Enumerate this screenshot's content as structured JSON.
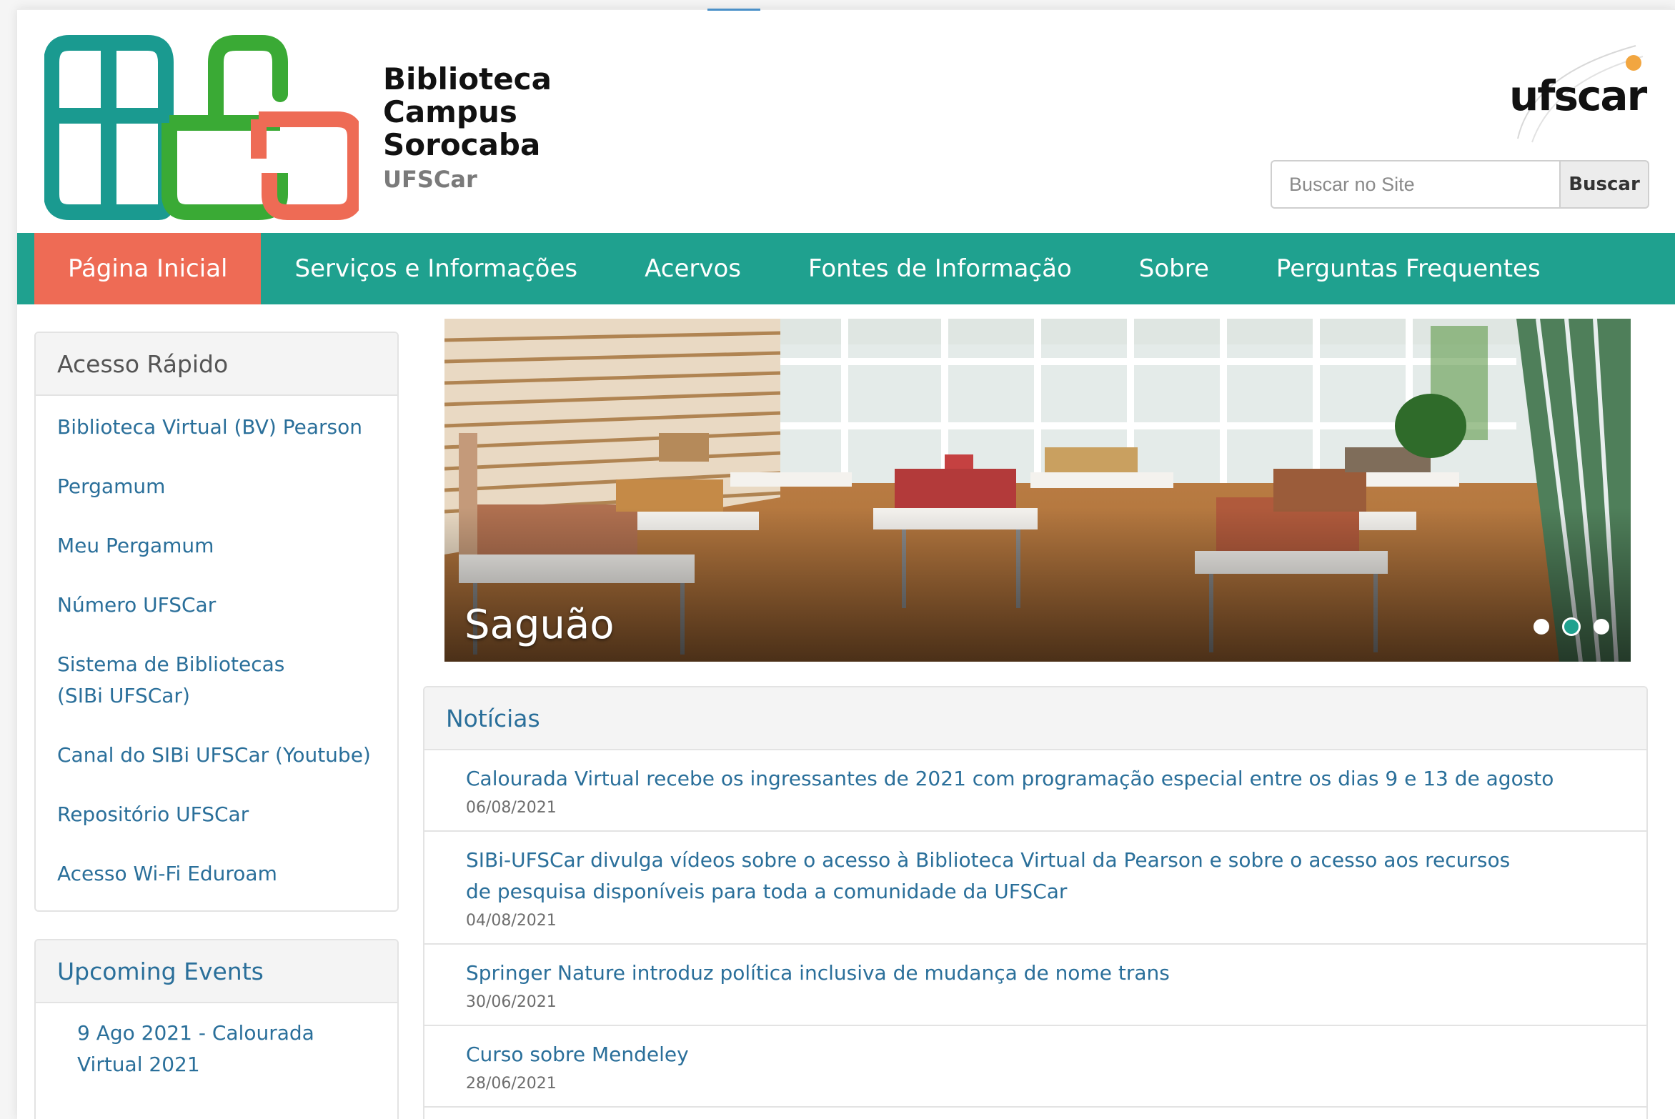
{
  "header": {
    "brand_lines": [
      "Biblioteca",
      "Campus",
      "Sorocaba"
    ],
    "brand_sub": "UFSCar",
    "partner_logo_text": "ufscar",
    "search": {
      "placeholder": "Buscar no Site",
      "button_label": "Buscar"
    }
  },
  "nav": {
    "items": [
      "Página Inicial",
      "Serviços e Informações",
      "Acervos",
      "Fontes de Informação",
      "Sobre",
      "Perguntas Frequentes"
    ],
    "active_index": 0
  },
  "sidebar": {
    "quick_access": {
      "title": "Acesso Rápido",
      "items": [
        "Biblioteca Virtual (BV) Pearson",
        "Pergamum",
        "Meu Pergamum",
        "Número UFSCar",
        "Sistema de Bibliotecas (SIBi UFSCar)",
        "Canal do SIBi UFSCar (Youtube)",
        "Repositório UFSCar",
        "Acesso Wi-Fi Eduroam"
      ]
    },
    "events": {
      "title": "Upcoming Events",
      "items": [
        "9 Ago 2021 - Calourada Virtual 2021"
      ]
    }
  },
  "slider": {
    "caption": "Saguão",
    "slide_count": 3,
    "active_slide": 1
  },
  "news": {
    "title": "Notícias",
    "items": [
      {
        "title": "Calourada Virtual recebe os ingressantes de 2021 com programação especial entre os dias 9 e 13 de agosto",
        "date": "06/08/2021"
      },
      {
        "title": "SIBi-UFSCar divulga vídeos sobre o acesso à Biblioteca Virtual da Pearson e sobre o acesso aos recursos de pesquisa disponíveis para toda a comunidade da UFSCar",
        "date": "04/08/2021"
      },
      {
        "title": "Springer Nature introduz política inclusiva de mudança de nome trans",
        "date": "30/06/2021"
      },
      {
        "title": "Curso sobre Mendeley",
        "date": "28/06/2021"
      }
    ]
  },
  "colors": {
    "teal": "#1fa18f",
    "coral": "#ee6b55",
    "green": "#3aaa35",
    "link": "#2a6f9a"
  }
}
